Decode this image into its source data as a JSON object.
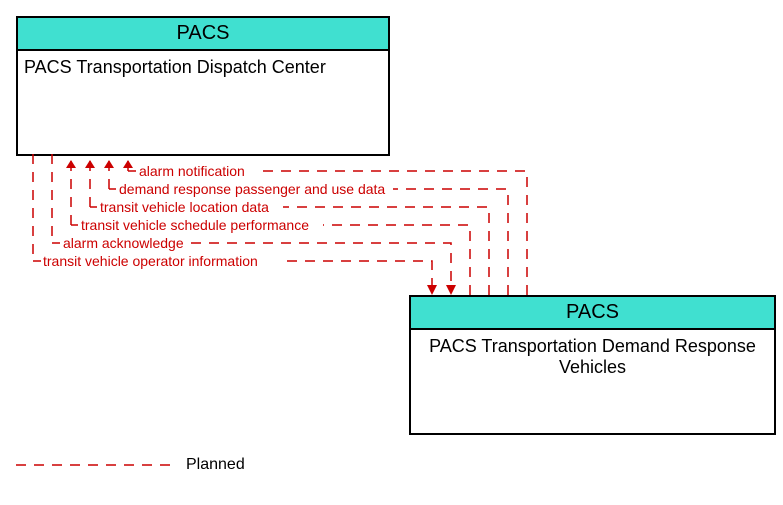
{
  "box1": {
    "header": "PACS",
    "body": "PACS Transportation Dispatch Center"
  },
  "box2": {
    "header": "PACS",
    "body": "PACS Transportation Demand Response Vehicles"
  },
  "flows": {
    "f1": "alarm notification",
    "f2": "demand response passenger and use data",
    "f3": "transit vehicle location data",
    "f4": "transit vehicle schedule performance",
    "f5": "alarm acknowledge",
    "f6": "transit vehicle operator information"
  },
  "legend": {
    "label": "Planned"
  }
}
